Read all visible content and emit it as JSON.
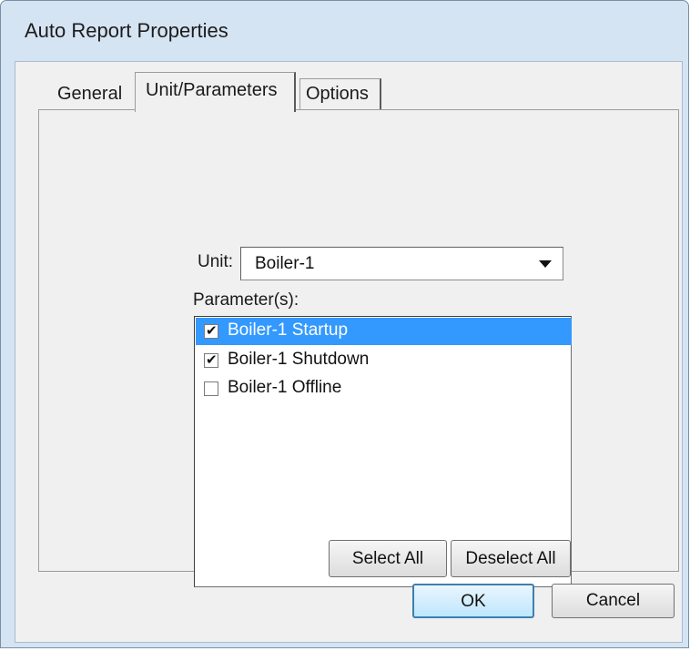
{
  "window": {
    "title": "Auto Report Properties"
  },
  "tabs": [
    {
      "label": "General",
      "active": false
    },
    {
      "label": "Unit/Parameters",
      "active": true
    },
    {
      "label": "Options",
      "active": false
    }
  ],
  "unit": {
    "label": "Unit:",
    "value": "Boiler-1"
  },
  "parameters": {
    "label": "Parameter(s):",
    "items": [
      {
        "label": "Boiler-1 Startup",
        "checked": true,
        "selected": true
      },
      {
        "label": "Boiler-1 Shutdown",
        "checked": true,
        "selected": false
      },
      {
        "label": "Boiler-1 Offline",
        "checked": false,
        "selected": false
      }
    ]
  },
  "buttons": {
    "select_all": "Select All",
    "deselect_all": "Deselect All",
    "ok": "OK",
    "cancel": "Cancel"
  },
  "colors": {
    "selection": "#3399ff",
    "frame": "#d5e4f3",
    "dialog_bg": "#f0f0f0"
  }
}
